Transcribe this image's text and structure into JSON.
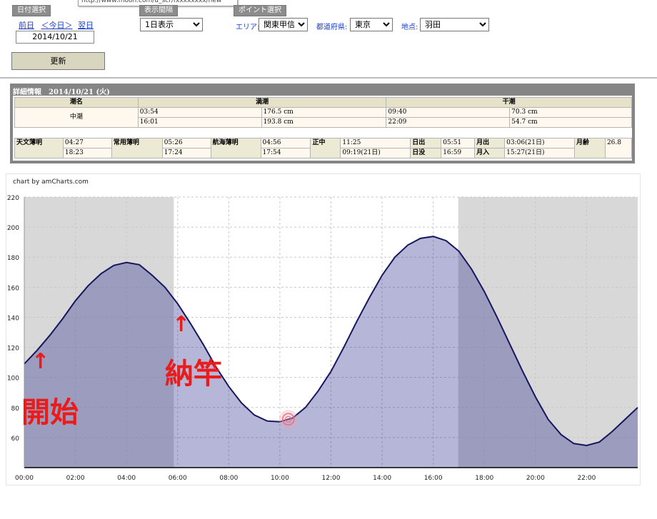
{
  "url_tooltip": "http://www.moon.com/u_scr/fxxxxxxxx/new",
  "date_panel": {
    "tab": "日付選択",
    "prev": "前日",
    "today": "＜今日＞",
    "next": "翌日",
    "date": "2014/10/21"
  },
  "interval_panel": {
    "tab": "表示間隔",
    "selected": "1日表示"
  },
  "point_panel": {
    "tab": "ポイント選択",
    "area_label": "エリア:",
    "area_value": "関東甲信",
    "pref_label": "都道府県:",
    "pref_value": "東京",
    "spot_label": "地点:",
    "spot_value": "羽田"
  },
  "refresh_label": "更新",
  "detail": {
    "title": "詳細情報　2014/10/21 (火)",
    "headers": {
      "tide_name": "潮名",
      "high": "満潮",
      "low": "干潮"
    },
    "tide_name": "中潮",
    "high": [
      {
        "time": "03:54",
        "level": "176.5 cm"
      },
      {
        "time": "16:01",
        "level": "193.8 cm"
      }
    ],
    "low": [
      {
        "time": "09:40",
        "level": "70.3 cm"
      },
      {
        "time": "22:09",
        "level": "54.7 cm"
      }
    ],
    "astro": [
      {
        "label": "天文薄明",
        "v1": "04:27",
        "v2": "18:23"
      },
      {
        "label": "常用薄明",
        "v1": "05:26",
        "v2": "17:24"
      },
      {
        "label": "航海薄明",
        "v1": "04:56",
        "v2": "17:54"
      },
      {
        "label": "正中",
        "v1": "11:25",
        "v2": "09:19(21日)"
      }
    ],
    "sun": {
      "rise_label": "日出",
      "rise": "05:51",
      "set_label": "日没",
      "set": "16:59"
    },
    "moon": {
      "rise_label": "月出",
      "rise": "03:06(21日)",
      "set_label": "月入",
      "set": "15:27(21日)"
    },
    "age_label": "月齢",
    "age": "26.8"
  },
  "chart_credit": "chart by amCharts.com",
  "annotations": {
    "start": "開始",
    "finish": "納竿"
  },
  "chart_data": {
    "type": "area",
    "x_unit": "hours",
    "xlim": [
      0,
      24
    ],
    "ylim": [
      40,
      220
    ],
    "yticks": [
      60,
      80,
      100,
      120,
      140,
      160,
      180,
      200,
      220
    ],
    "xticks": [
      "00:00",
      "02:00",
      "04:00",
      "06:00",
      "08:00",
      "10:00",
      "12:00",
      "14:00",
      "16:00",
      "18:00",
      "20:00",
      "22:00"
    ],
    "series": [
      {
        "x": [
          0,
          0.5,
          1,
          1.5,
          2,
          2.5,
          3,
          3.5,
          4,
          4.5,
          5,
          5.5,
          6,
          6.5,
          7,
          7.5,
          8,
          8.5,
          9,
          9.5,
          10,
          10.5,
          11,
          11.5,
          12,
          12.5,
          13,
          13.5,
          14,
          14.5,
          15,
          15.5,
          16,
          16.5,
          17,
          17.5,
          18,
          18.5,
          19,
          19.5,
          20,
          20.5,
          21,
          21.5,
          22,
          22.5,
          23,
          23.5,
          24
        ],
        "y": [
          109,
          118,
          128,
          139,
          151,
          161,
          169,
          174.5,
          176.5,
          175,
          168,
          160,
          149,
          136,
          122,
          107,
          94,
          83,
          75,
          71,
          70.5,
          73,
          80,
          91,
          104,
          120,
          137,
          153,
          168,
          180,
          188,
          192.5,
          193.8,
          191,
          184,
          172,
          157,
          140,
          122,
          104,
          87,
          72,
          62,
          56,
          54.7,
          57,
          64,
          72,
          80
        ]
      }
    ],
    "night_bands": [
      [
        0,
        5.85
      ],
      [
        16.98,
        24
      ]
    ],
    "marker_time": 10.33,
    "grid": true
  }
}
